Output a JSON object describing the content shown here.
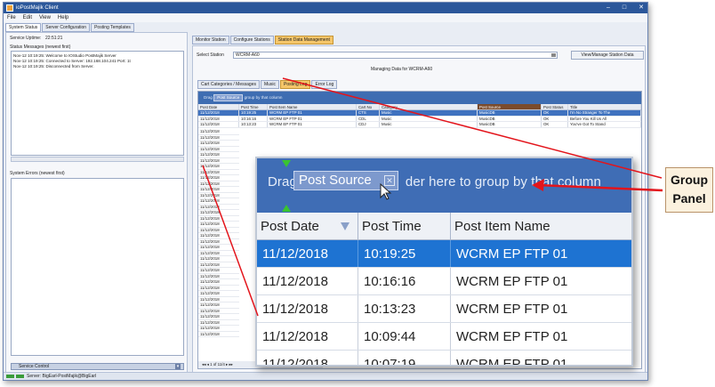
{
  "window": {
    "title": "ioPostMajik Client",
    "controls": [
      "–",
      "□",
      "✕"
    ]
  },
  "menu": [
    "File",
    "Edit",
    "View",
    "Help"
  ],
  "left_tabs": [
    "System Status",
    "Server Configuration",
    "Posting Templates"
  ],
  "left_panel": {
    "uptime_label": "Service Uptime:",
    "uptime_value": "22:51:21",
    "status_heading": "Status Messages (newest first)",
    "messages": [
      "Nov-12 10:19:25: Welcome to IOStudio PostMajik Server",
      "Nov-12 10:19:25: Connected to Server: 192.168.104.241 Port: 1t",
      "Nov-12 10:19:25: Disconnected from Server."
    ],
    "errors_heading": "System Errors (newest first)",
    "service_control": "Service Control"
  },
  "status_bar": {
    "server_text": "Server: BigEarl-PostMajik@BigEarl"
  },
  "right_tabs": [
    "Monitor Station",
    "Configure Stations",
    "Station Data Management"
  ],
  "station": {
    "select_label": "Select Station",
    "selected": "WCRM-A60",
    "view_button": "View/Manage Station Data",
    "managing_label": "Managing Data for WCRM-A60"
  },
  "sub_tabs": [
    "Cart Categories / Messages",
    "Music",
    "Posting Log",
    "Error Log"
  ],
  "small_grid": {
    "group_chip": "Post Source",
    "group_text": "group by that column",
    "drag_prefix": "Drag",
    "columns": [
      "Post Date",
      "Post Time",
      "Post Item Name",
      "Cart No",
      "Category",
      "Post Source",
      "Post Status",
      "Title"
    ],
    "rows": [
      [
        "11/12/2018",
        "10:19:25",
        "WCRM EP FTP 01",
        "CTS",
        "Music",
        "MusicDB",
        "OK",
        "I'm No Stranger To The"
      ],
      [
        "11/12/2018",
        "10:16:16",
        "WCRM EP FTP 01",
        "CDL",
        "Music",
        "MusicDB",
        "OK",
        "Before You Kill Us All"
      ],
      [
        "11/12/2018",
        "10:13:23",
        "WCRM EP FTP 01",
        "CDJ",
        "Music",
        "MusicDB",
        "OK",
        "You've Got To Stand"
      ]
    ],
    "extra_dates": [
      "11/12/2018",
      "11/12/2018",
      "11/12/2018",
      "11/12/2018",
      "11/12/2018",
      "11/12/2018",
      "11/12/2018",
      "11/12/2018",
      "11/12/2018",
      "11/12/2018",
      "11/12/2018",
      "11/12/2018",
      "11/12/2018",
      "11/12/2018",
      "11/12/2018",
      "11/12/2018",
      "11/12/2018",
      "11/12/2018",
      "11/12/2018",
      "11/12/2018",
      "11/12/2018",
      "11/12/2018",
      "11/12/2018",
      "11/12/2018",
      "11/12/2018",
      "11/12/2018",
      "11/12/2018",
      "11/12/2018",
      "11/12/2018",
      "11/12/2018",
      "11/12/2018",
      "11/12/2018",
      "11/12/2018",
      "11/12/2018",
      "11/12/2018",
      "11/12/2018"
    ],
    "extra_suffix": "10",
    "pager": "1 of 11/4"
  },
  "zoom": {
    "drag_prefix": "Drag",
    "chip_label": "Post Source",
    "drag_middle": "der here to",
    "drag_suffix": "group by that column",
    "col1": "Post Date",
    "col2": "Post Time",
    "col3": "Post Item Name",
    "rows": [
      [
        "11/12/2018",
        "10:19:25",
        "WCRM EP FTP 01"
      ],
      [
        "11/12/2018",
        "10:16:16",
        "WCRM EP FTP 01"
      ],
      [
        "11/12/2018",
        "10:13:23",
        "WCRM EP FTP 01"
      ],
      [
        "11/12/2018",
        "10:09:44",
        "WCRM EP FTP 01"
      ],
      [
        "11/12/2018",
        "10:07:19",
        "WCRM EP FTP 01"
      ]
    ]
  },
  "annotation": {
    "line1": "Group",
    "line2": "Panel"
  },
  "colors": {
    "accent": "#3f6db5",
    "selected_row": "#1e73d2",
    "arrow": "#e3141b",
    "callout_fill": "#fbf1de",
    "active_tab": "#f5c66a"
  }
}
